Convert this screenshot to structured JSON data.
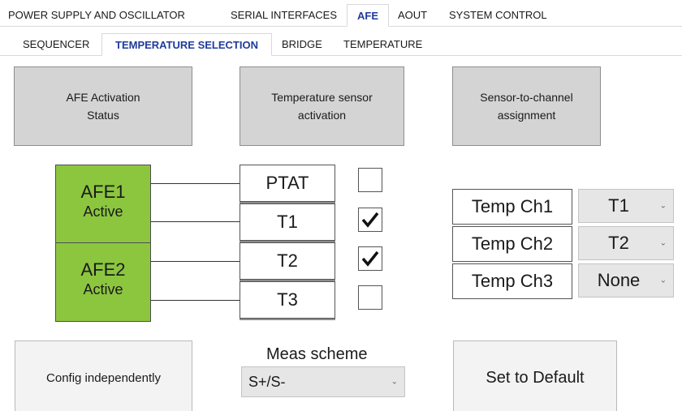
{
  "tabs_main": [
    {
      "label": "POWER SUPPLY AND OSCILLATOR",
      "active": false
    },
    {
      "label": "SERIAL INTERFACES",
      "active": false
    },
    {
      "label": "AFE",
      "active": true
    },
    {
      "label": "AOUT",
      "active": false
    },
    {
      "label": "SYSTEM CONTROL",
      "active": false
    }
  ],
  "tabs_sub": [
    {
      "label": "SEQUENCER",
      "active": false
    },
    {
      "label": "TEMPERATURE SELECTION",
      "active": true
    },
    {
      "label": "BRIDGE",
      "active": false
    },
    {
      "label": "TEMPERATURE",
      "active": false
    }
  ],
  "headers": {
    "afe_status": [
      "AFE Activation",
      "Status"
    ],
    "sensor_activation": [
      "Temperature sensor",
      "activation"
    ],
    "channel_assignment": [
      "Sensor-to-channel",
      "assignment"
    ]
  },
  "afe_blocks": [
    {
      "name": "AFE1",
      "status": "Active"
    },
    {
      "name": "AFE2",
      "status": "Active"
    }
  ],
  "sensors": [
    {
      "label": "PTAT",
      "checked": false
    },
    {
      "label": "T1",
      "checked": true
    },
    {
      "label": "T2",
      "checked": true
    },
    {
      "label": "T3",
      "checked": false
    }
  ],
  "channels": [
    {
      "label": "Temp Ch1",
      "value": "T1"
    },
    {
      "label": "Temp Ch2",
      "value": "T2"
    },
    {
      "label": "Temp Ch3",
      "value": "None"
    }
  ],
  "buttons": {
    "config_independently": "Config independently",
    "set_default": "Set to Default"
  },
  "meas_scheme": {
    "label": "Meas scheme",
    "value": "S+/S-"
  },
  "icons": {
    "checkmark": "checkmark-icon",
    "dropdown": "chevron-down-icon"
  },
  "colors": {
    "active_tab_text": "#1f3b9c",
    "afe_active": "#8cc63f",
    "header_button": "#d4d4d4"
  }
}
